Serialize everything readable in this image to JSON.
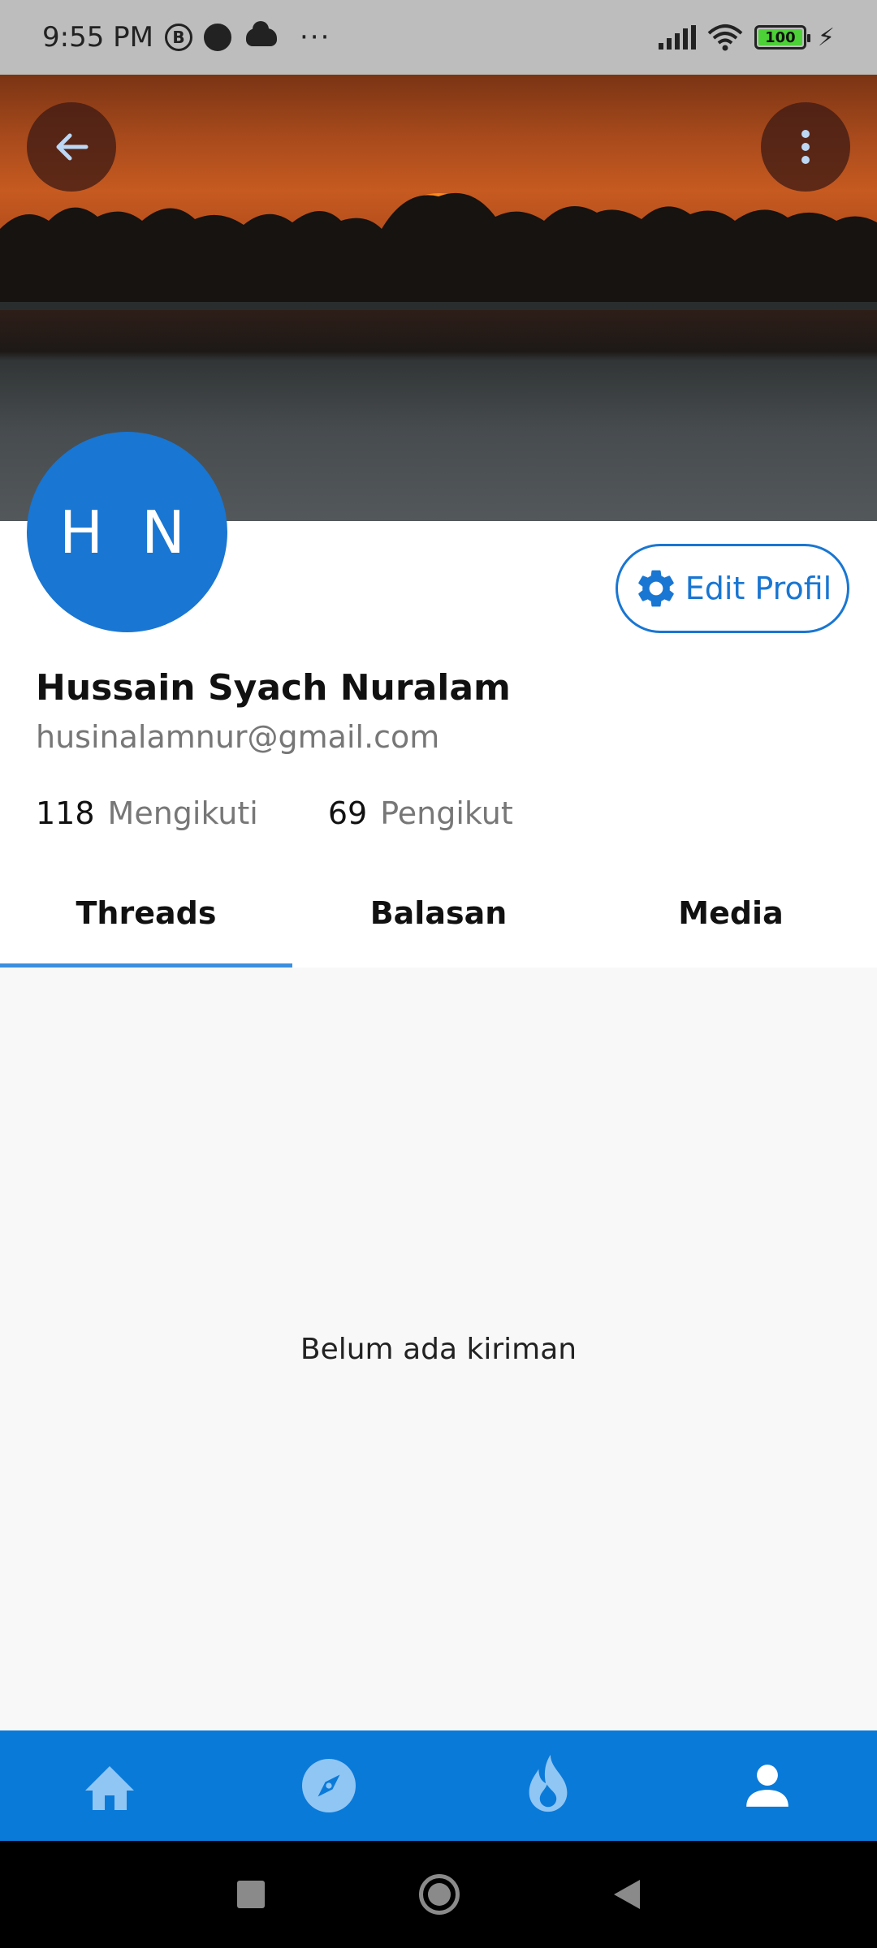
{
  "status_bar": {
    "time": "9:55 PM",
    "icon_b": "B",
    "dots": "···",
    "battery_level": "100",
    "icons": [
      "b-circle-icon",
      "half-circle-icon",
      "cloud-icon",
      "more-dots",
      "signal-icon",
      "wifi-icon",
      "battery-icon",
      "charging-bolt-icon"
    ]
  },
  "cover": {
    "back_icon": "arrow-back-icon",
    "menu_icon": "more-vert-icon"
  },
  "profile": {
    "avatar_initials": "H N",
    "edit_button_label": "Edit Profil",
    "edit_icon": "gear-icon",
    "name": "Hussain Syach Nuralam",
    "email": "husinalamnur@gmail.com",
    "following_count": "118",
    "following_label": "Mengikuti",
    "followers_count": "69",
    "followers_label": "Pengikut"
  },
  "tabs": [
    {
      "label": "Threads",
      "active": true
    },
    {
      "label": "Balasan",
      "active": false
    },
    {
      "label": "Media",
      "active": false
    }
  ],
  "empty_state": {
    "message": "Belum ada kiriman"
  },
  "bottom_nav": {
    "items": [
      "home-icon",
      "explore-compass-icon",
      "fire-icon",
      "person-icon"
    ],
    "active_index": 3
  },
  "colors": {
    "primary": "#1976d2",
    "bottom_nav": "#0a7ad9",
    "tab_indicator": "#3b8fe0"
  }
}
